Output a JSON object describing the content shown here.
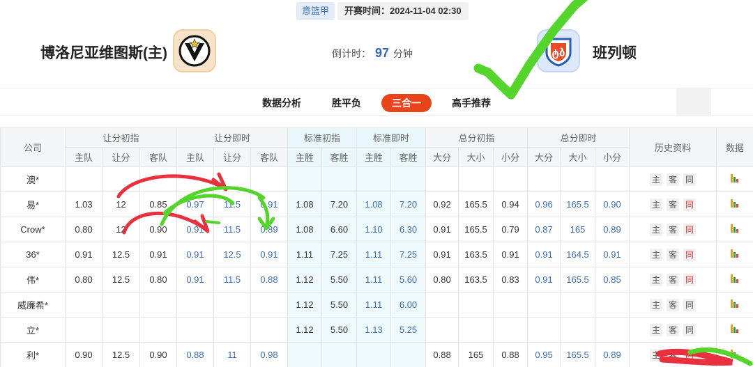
{
  "header": {
    "league": "意篮甲",
    "start_time": "开赛时间：2024-11-04 02:30",
    "home_team": "博洛尼亚维图斯(主)",
    "away_team": "班列顿",
    "countdown_label": "倒计时：",
    "countdown_value": "97",
    "countdown_unit": "分钟"
  },
  "tabs": [
    {
      "label": "数据分析",
      "active": false
    },
    {
      "label": "胜平负",
      "active": false
    },
    {
      "label": "三合一",
      "active": true
    },
    {
      "label": "高手推荐",
      "active": false
    }
  ],
  "table": {
    "group_headers": {
      "company": "公司",
      "handicap_init": "让分初指",
      "handicap_live": "让分即时",
      "std_init": "标准初指",
      "std_live": "标准即时",
      "total_init": "总分初指",
      "total_live": "总分即时",
      "history": "历史资料",
      "data": "数据"
    },
    "sub_headers": [
      "主队",
      "让分",
      "客队",
      "主队",
      "让分",
      "客队",
      "主胜",
      "客胜",
      "主胜",
      "客胜",
      "大分",
      "大小",
      "小分",
      "大分",
      "大小",
      "小分"
    ],
    "history_buttons": [
      "主",
      "客",
      "同"
    ],
    "rows": [
      {
        "company": "澳*",
        "cells": [
          "",
          "",
          "",
          "",
          "",
          "",
          "",
          "",
          "",
          "",
          "",
          "",
          "",
          "",
          "",
          ""
        ],
        "same_red": false
      },
      {
        "company": "易*",
        "cells": [
          "1.03",
          "12",
          "0.85",
          "0.97",
          "11.5",
          "0.91",
          "1.08",
          "7.20",
          "1.08",
          "7.20",
          "0.92",
          "165.5",
          "0.94",
          "0.96",
          "165.5",
          "0.90"
        ],
        "same_red": true
      },
      {
        "company": "Crow*",
        "cells": [
          "0.80",
          "12",
          "0.90",
          "0.91",
          "11.5",
          "0.89",
          "1.08",
          "6.60",
          "1.10",
          "6.30",
          "0.91",
          "165.5",
          "0.79",
          "0.87",
          "165",
          "0.89"
        ],
        "same_red": true
      },
      {
        "company": "36*",
        "cells": [
          "0.91",
          "12.5",
          "0.91",
          "0.91",
          "12.5",
          "0.91",
          "1.11",
          "7.25",
          "1.11",
          "7.25",
          "0.91",
          "163.5",
          "0.91",
          "0.91",
          "164.5",
          "0.91"
        ],
        "same_red": true
      },
      {
        "company": "伟*",
        "cells": [
          "0.80",
          "12.5",
          "0.80",
          "0.91",
          "11.5",
          "0.88",
          "1.12",
          "5.50",
          "1.11",
          "5.60",
          "0.80",
          "163.5",
          "0.83",
          "0.91",
          "165.5",
          "0.85"
        ],
        "same_red": true
      },
      {
        "company": "威廉希*",
        "cells": [
          "",
          "",
          "",
          "",
          "",
          "",
          "1.12",
          "5.50",
          "1.11",
          "6.00",
          "",
          "",
          "",
          "",
          "",
          ""
        ],
        "same_red": false
      },
      {
        "company": "立*",
        "cells": [
          "",
          "",
          "",
          "",
          "",
          "",
          "1.12",
          "5.50",
          "1.13",
          "5.25",
          "",
          "",
          "",
          "",
          "",
          ""
        ],
        "same_red": false
      },
      {
        "company": "利*",
        "cells": [
          "0.90",
          "12.5",
          "0.90",
          "0.88",
          "11",
          "0.98",
          "",
          "",
          "",
          "",
          "0.88",
          "165",
          "0.88",
          "0.95",
          "165.5",
          "0.89"
        ],
        "same_red": true
      }
    ]
  },
  "colors": {
    "accent_tab": "#e8441c",
    "live_value": "#3a6db5",
    "history_red": "#d94040",
    "annotation_red": "#e8303f",
    "annotation_green": "#55d42c"
  },
  "icons": {
    "home_logo": "virtus-v-star-icon",
    "away_logo": "club-crest-icon",
    "data_column": "bar-chart-icon",
    "checkmark": "check-mark-icon"
  }
}
